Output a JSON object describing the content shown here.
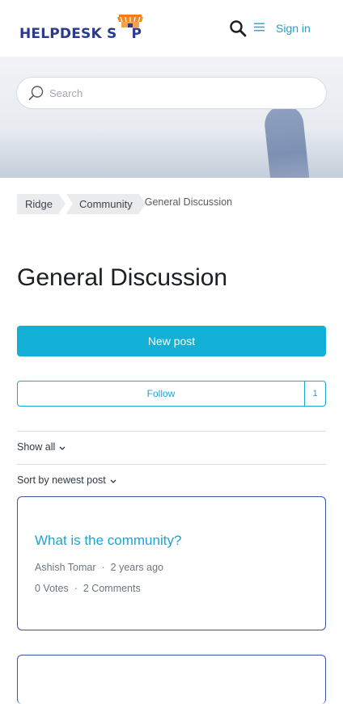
{
  "header": {
    "logo_text_left": "HELPDESK S",
    "logo_text_o": "",
    "logo_text_right": "P",
    "signin_label": "Sign in",
    "search_icon": "search-icon",
    "menu_icon": "menu-icon"
  },
  "hero": {
    "search_placeholder": "Search"
  },
  "breadcrumb": {
    "items": [
      "Ridge",
      "Community"
    ],
    "current": "General Discussion"
  },
  "page": {
    "title": "General Discussion",
    "new_post_label": "New post",
    "follow_label": "Follow",
    "follow_count": "1",
    "show_all_label": "Show all",
    "sort_label": "Sort by newest post"
  },
  "posts": [
    {
      "title": "What is the community?",
      "author": "Ashish Tomar",
      "time": "2 years ago",
      "votes": "0 Votes",
      "comments": "2 Comments"
    }
  ],
  "colors": {
    "accent": "#12b0d6",
    "link": "#1fa3cf",
    "logo": "#2b3a8c",
    "card_border": "#3a56a6"
  }
}
